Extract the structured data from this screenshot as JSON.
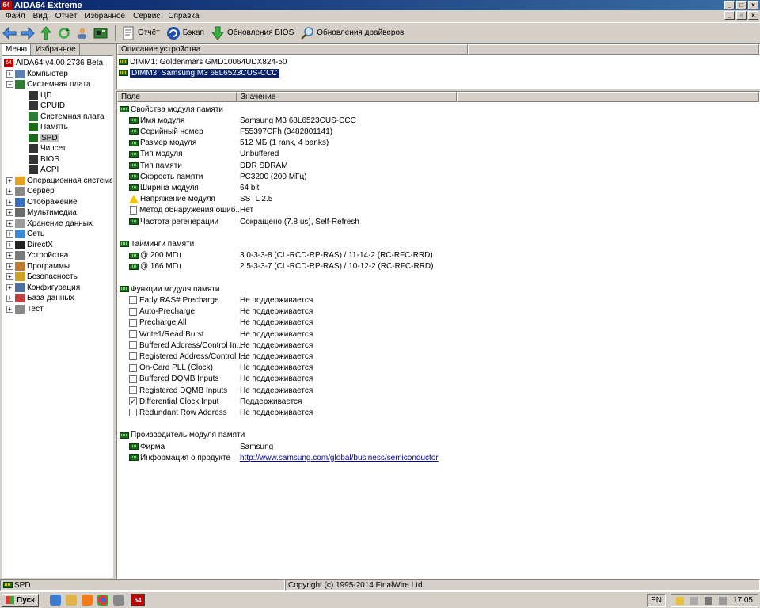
{
  "window": {
    "title": "AIDA64 Extreme",
    "app_icon": "64"
  },
  "menubar": [
    "Файл",
    "Вид",
    "Отчёт",
    "Избранное",
    "Сервис",
    "Справка"
  ],
  "toolbar": {
    "report": "Отчёт",
    "backup": "Бэкап",
    "bios_update": "Обновления BIOS",
    "driver_update": "Обновления драйверов"
  },
  "left_tabs": {
    "menu": "Меню",
    "favorites": "Избранное"
  },
  "tree": [
    {
      "label": "AIDA64 v4.00.2736 Beta",
      "level": 0,
      "exp": "",
      "icon": "aida-icon"
    },
    {
      "label": "Компьютер",
      "level": 1,
      "exp": "+",
      "icon": "computer-icon"
    },
    {
      "label": "Системная плата",
      "level": 1,
      "exp": "-",
      "icon": "motherboard-icon"
    },
    {
      "label": "ЦП",
      "level": 2,
      "exp": "",
      "icon": "cpu-icon"
    },
    {
      "label": "CPUID",
      "level": 2,
      "exp": "",
      "icon": "cpuid-icon"
    },
    {
      "label": "Системная плата",
      "level": 2,
      "exp": "",
      "icon": "motherboard-icon"
    },
    {
      "label": "Память",
      "level": 2,
      "exp": "",
      "icon": "memory-icon"
    },
    {
      "label": "SPD",
      "level": 2,
      "exp": "",
      "icon": "memory-icon",
      "selected": true
    },
    {
      "label": "Чипсет",
      "level": 2,
      "exp": "",
      "icon": "chipset-icon"
    },
    {
      "label": "BIOS",
      "level": 2,
      "exp": "",
      "icon": "bios-icon"
    },
    {
      "label": "ACPI",
      "level": 2,
      "exp": "",
      "icon": "acpi-icon"
    },
    {
      "label": "Операционная система",
      "level": 1,
      "exp": "+",
      "icon": "windows-icon"
    },
    {
      "label": "Сервер",
      "level": 1,
      "exp": "+",
      "icon": "server-icon"
    },
    {
      "label": "Отображение",
      "level": 1,
      "exp": "+",
      "icon": "display-icon"
    },
    {
      "label": "Мультимедиа",
      "level": 1,
      "exp": "+",
      "icon": "multimedia-icon"
    },
    {
      "label": "Хранение данных",
      "level": 1,
      "exp": "+",
      "icon": "storage-icon"
    },
    {
      "label": "Сеть",
      "level": 1,
      "exp": "+",
      "icon": "network-icon"
    },
    {
      "label": "DirectX",
      "level": 1,
      "exp": "+",
      "icon": "directx-icon"
    },
    {
      "label": "Устройства",
      "level": 1,
      "exp": "+",
      "icon": "devices-icon"
    },
    {
      "label": "Программы",
      "level": 1,
      "exp": "+",
      "icon": "programs-icon"
    },
    {
      "label": "Безопасность",
      "level": 1,
      "exp": "+",
      "icon": "security-icon"
    },
    {
      "label": "Конфигурация",
      "level": 1,
      "exp": "+",
      "icon": "config-icon"
    },
    {
      "label": "База данных",
      "level": 1,
      "exp": "+",
      "icon": "database-icon"
    },
    {
      "label": "Тест",
      "level": 1,
      "exp": "+",
      "icon": "benchmark-icon"
    }
  ],
  "device_list": {
    "header": "Описание устройства",
    "items": [
      {
        "label": "DIMM1: Goldenmars GMD10064UDX824-50",
        "selected": false
      },
      {
        "label": "DIMM3: Samsung M3 68L6523CUS-CCC",
        "selected": true
      }
    ]
  },
  "details": {
    "col_field": "Поле",
    "col_value": "Значение",
    "rows": [
      {
        "kind": "group",
        "field": "Свойства модуля памяти"
      },
      {
        "kind": "item",
        "icon": "ram",
        "field": "Имя модуля",
        "value": "Samsung M3 68L6523CUS-CCC"
      },
      {
        "kind": "item",
        "icon": "ram",
        "field": "Серийный номер",
        "value": "F55397CFh (3482801141)"
      },
      {
        "kind": "item",
        "icon": "ram",
        "field": "Размер модуля",
        "value": "512 МБ (1 rank, 4 banks)"
      },
      {
        "kind": "item",
        "icon": "ram",
        "field": "Тип модуля",
        "value": "Unbuffered"
      },
      {
        "kind": "item",
        "icon": "ram",
        "field": "Тип памяти",
        "value": "DDR SDRAM"
      },
      {
        "kind": "item",
        "icon": "ram",
        "field": "Скорость памяти",
        "value": "PC3200 (200 МГц)"
      },
      {
        "kind": "item",
        "icon": "ram",
        "field": "Ширина модуля",
        "value": "64 bit"
      },
      {
        "kind": "item",
        "icon": "warn",
        "field": "Напряжение модуля",
        "value": "SSTL 2.5"
      },
      {
        "kind": "item",
        "icon": "doc",
        "field": "Метод обнаружения ошиб...",
        "value": "Нет"
      },
      {
        "kind": "item",
        "icon": "ram",
        "field": "Частота регенерации",
        "value": "Сокращено (7.8 us), Self-Refresh"
      },
      {
        "kind": "blank"
      },
      {
        "kind": "group",
        "field": "Тайминги памяти"
      },
      {
        "kind": "item",
        "icon": "ram",
        "field": "@ 200 МГц",
        "value": "3.0-3-3-8  (CL-RCD-RP-RAS) / 11-14-2  (RC-RFC-RRD)"
      },
      {
        "kind": "item",
        "icon": "ram",
        "field": "@ 166 МГц",
        "value": "2.5-3-3-7  (CL-RCD-RP-RAS) / 10-12-2  (RC-RFC-RRD)"
      },
      {
        "kind": "blank"
      },
      {
        "kind": "group",
        "field": "Функции модуля памяти"
      },
      {
        "kind": "check",
        "checked": false,
        "field": "Early RAS# Precharge",
        "value": "Не поддерживается"
      },
      {
        "kind": "check",
        "checked": false,
        "field": "Auto-Precharge",
        "value": "Не поддерживается"
      },
      {
        "kind": "check",
        "checked": false,
        "field": "Precharge All",
        "value": "Не поддерживается"
      },
      {
        "kind": "check",
        "checked": false,
        "field": "Write1/Read Burst",
        "value": "Не поддерживается"
      },
      {
        "kind": "check",
        "checked": false,
        "field": "Buffered Address/Control In...",
        "value": "Не поддерживается"
      },
      {
        "kind": "check",
        "checked": false,
        "field": "Registered Address/Control I...",
        "value": "Не поддерживается"
      },
      {
        "kind": "check",
        "checked": false,
        "field": "On-Card PLL (Clock)",
        "value": "Не поддерживается"
      },
      {
        "kind": "check",
        "checked": false,
        "field": "Buffered DQMB Inputs",
        "value": "Не поддерживается"
      },
      {
        "kind": "check",
        "checked": false,
        "field": "Registered DQMB Inputs",
        "value": "Не поддерживается"
      },
      {
        "kind": "check",
        "checked": true,
        "field": "Differential Clock Input",
        "value": "Поддерживается"
      },
      {
        "kind": "check",
        "checked": false,
        "field": "Redundant Row Address",
        "value": "Не поддерживается"
      },
      {
        "kind": "blank"
      },
      {
        "kind": "group",
        "field": "Производитель модуля памяти"
      },
      {
        "kind": "item",
        "icon": "ram",
        "field": "Фирма",
        "value": "Samsung"
      },
      {
        "kind": "item",
        "icon": "ram",
        "field": "Информация о продукте",
        "value": "http://www.samsung.com/global/business/semiconductor",
        "link": true
      }
    ]
  },
  "statusbar": {
    "left": "SPD",
    "right": "Copyright (c) 1995-2014 FinalWire Ltd."
  },
  "taskbar": {
    "start": "Пуск",
    "lang": "EN",
    "time": "17:05",
    "active_task": "64"
  }
}
